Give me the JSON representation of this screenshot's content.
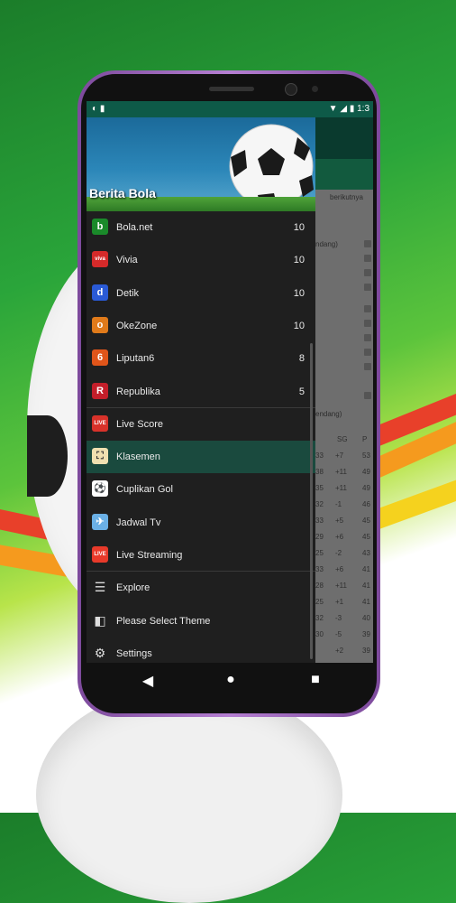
{
  "status_bar": {
    "left_icons": "◐ ▮",
    "right": "▼ ◢ ▮ 1:3"
  },
  "drawer": {
    "title": "Berita Bola",
    "sources": [
      {
        "label": "Bola.net",
        "count": "10",
        "color": "#1a8a2a",
        "glyph": "b"
      },
      {
        "label": "Vivia",
        "count": "10",
        "color": "#d62a2a",
        "glyph": "viva"
      },
      {
        "label": "Detik",
        "count": "10",
        "color": "#2a5ad6",
        "glyph": "d"
      },
      {
        "label": "OkeZone",
        "count": "10",
        "color": "#e07a1a",
        "glyph": "o"
      },
      {
        "label": "Liputan6",
        "count": "8",
        "color": "#e0551a",
        "glyph": "6"
      },
      {
        "label": "Republika",
        "count": "5",
        "color": "#c41e2a",
        "glyph": "R"
      }
    ],
    "tools": [
      {
        "label": "Live Score",
        "color": "#d8322a",
        "glyph": "LIVE"
      },
      {
        "label": "Klasemen",
        "color": "#f0e0b0",
        "glyph": "⛶",
        "active": true
      },
      {
        "label": "Cuplikan Gol",
        "color": "#ffffff",
        "glyph": "⚽"
      },
      {
        "label": "Jadwal Tv",
        "color": "#6ab0e6",
        "glyph": "✈"
      },
      {
        "label": "Live Streaming",
        "color": "#e83a2a",
        "glyph": "LIVE"
      }
    ],
    "settings": [
      {
        "label": "Explore",
        "glyph": "☰"
      },
      {
        "label": "Please Select Theme",
        "glyph": "◧"
      },
      {
        "label": "Settings",
        "glyph": "⚙"
      }
    ]
  },
  "background_app": {
    "sub_text": "berikutnya",
    "group_text": "ndang)",
    "section_text": "endang)",
    "col_headers": [
      "SG",
      "P"
    ],
    "rows": [
      [
        "+7",
        "53"
      ],
      [
        "+11",
        "49"
      ],
      [
        "+11",
        "49"
      ],
      [
        "-1",
        "46"
      ],
      [
        "+5",
        "45"
      ],
      [
        "+6",
        "45"
      ],
      [
        "-2",
        "43"
      ],
      [
        "+6",
        "41"
      ],
      [
        "+11",
        "41"
      ],
      [
        "+1",
        "41"
      ],
      [
        "-3",
        "40"
      ],
      [
        "-5",
        "39"
      ],
      [
        "+2",
        "39"
      ]
    ],
    "left_nums": [
      "33",
      "38",
      "35",
      "32",
      "33",
      "29",
      "25",
      "33",
      "28",
      "25",
      "32",
      "30"
    ]
  },
  "nav": {
    "back": "◀",
    "home": "●",
    "recent": "■"
  }
}
